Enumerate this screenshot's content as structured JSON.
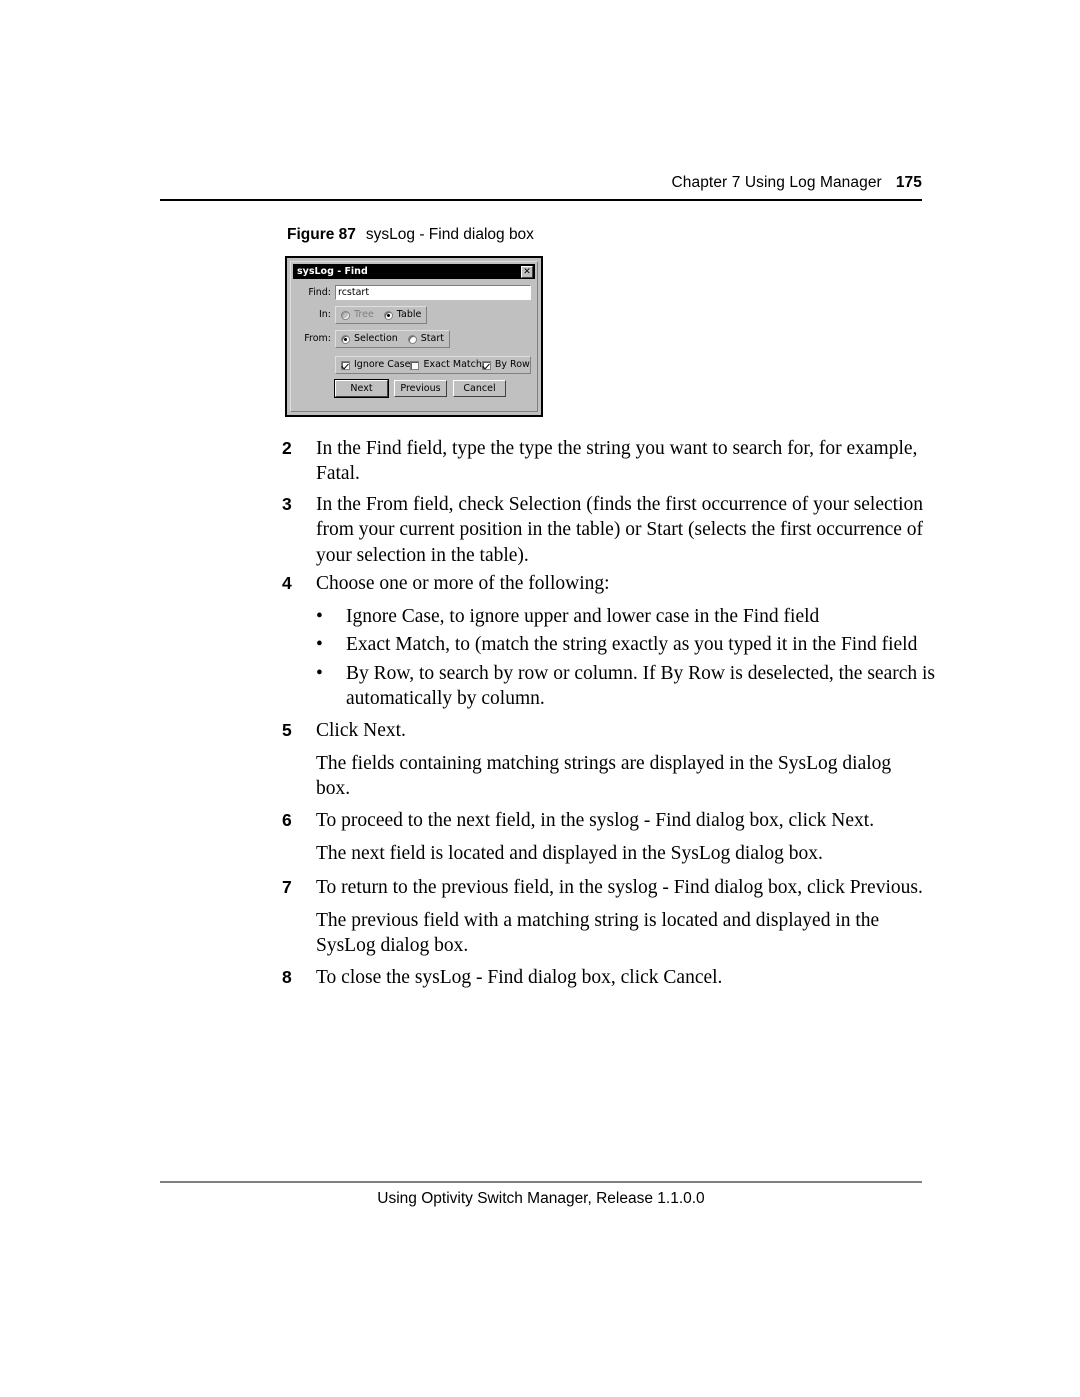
{
  "page": {
    "running_header": {
      "chapter": "Chapter 7  Using Log Manager",
      "page_number": "175"
    },
    "footer": "Using Optivity Switch Manager, Release 1.1.0.0"
  },
  "figure": {
    "number": "Figure 87",
    "caption": "sysLog - Find dialog box"
  },
  "dialog": {
    "title": "sysLog - Find",
    "close_icon": "close-icon",
    "close_glyph": "✕",
    "find": {
      "label": "Find:",
      "value": "rcstart",
      "placeholder": ""
    },
    "in": {
      "label": "In:",
      "options": [
        {
          "label": "Tree",
          "selected": false,
          "disabled": true
        },
        {
          "label": "Table",
          "selected": true,
          "disabled": false
        }
      ]
    },
    "from": {
      "label": "From:",
      "options": [
        {
          "label": "Selection",
          "selected": true,
          "disabled": false
        },
        {
          "label": "Start",
          "selected": false,
          "disabled": false
        }
      ]
    },
    "checkboxes": [
      {
        "label": "Ignore Case",
        "checked": true
      },
      {
        "label": "Exact Match",
        "checked": false
      },
      {
        "label": "By Row",
        "checked": true
      }
    ],
    "buttons": [
      {
        "label": "Next",
        "default": true
      },
      {
        "label": "Previous",
        "default": false
      },
      {
        "label": "Cancel",
        "default": false
      }
    ],
    "colors": {
      "face": "#c0c0c0",
      "titlebar": "#000000",
      "titlebar_text": "#ffffff",
      "field": "#ffffff",
      "disabled_text": "#808080"
    }
  },
  "steps": [
    {
      "num": "2",
      "text": "In the Find field, type the type the string you want to search for, for example, Fatal."
    },
    {
      "num": "3",
      "text": "In the From field, check Selection (finds the first occurrence of your selection from your current position in the table) or Start (selects the first occurrence of your selection in the table)."
    },
    {
      "num": "4",
      "text": "Choose one or more of the following:"
    },
    {
      "num": "5",
      "text": "Click Next."
    },
    {
      "num": "6",
      "text": "To proceed to the next field, in the syslog - Find dialog box, click Next."
    },
    {
      "num": "7",
      "text": "To return to the previous field, in the syslog - Find dialog box, click Previous."
    },
    {
      "num": "8",
      "text": "To close the sysLog - Find dialog box, click Cancel."
    }
  ],
  "bullets": [
    {
      "marker": "•",
      "text": "Ignore Case, to ignore upper and lower case in the Find field"
    },
    {
      "marker": "•",
      "text": "Exact Match, to (match the string exactly as you typed it in the Find field"
    },
    {
      "marker": "•",
      "text": "By Row, to search by row or column. If By Row is deselected, the search is automatically by column."
    }
  ],
  "paragraphs": {
    "after_step5": "The fields containing matching strings are displayed in the SysLog dialog box.",
    "after_step6": "The next field is located and displayed in the SysLog dialog box.",
    "after_step7": "The previous field with a matching string is located and displayed in the SysLog dialog box."
  }
}
